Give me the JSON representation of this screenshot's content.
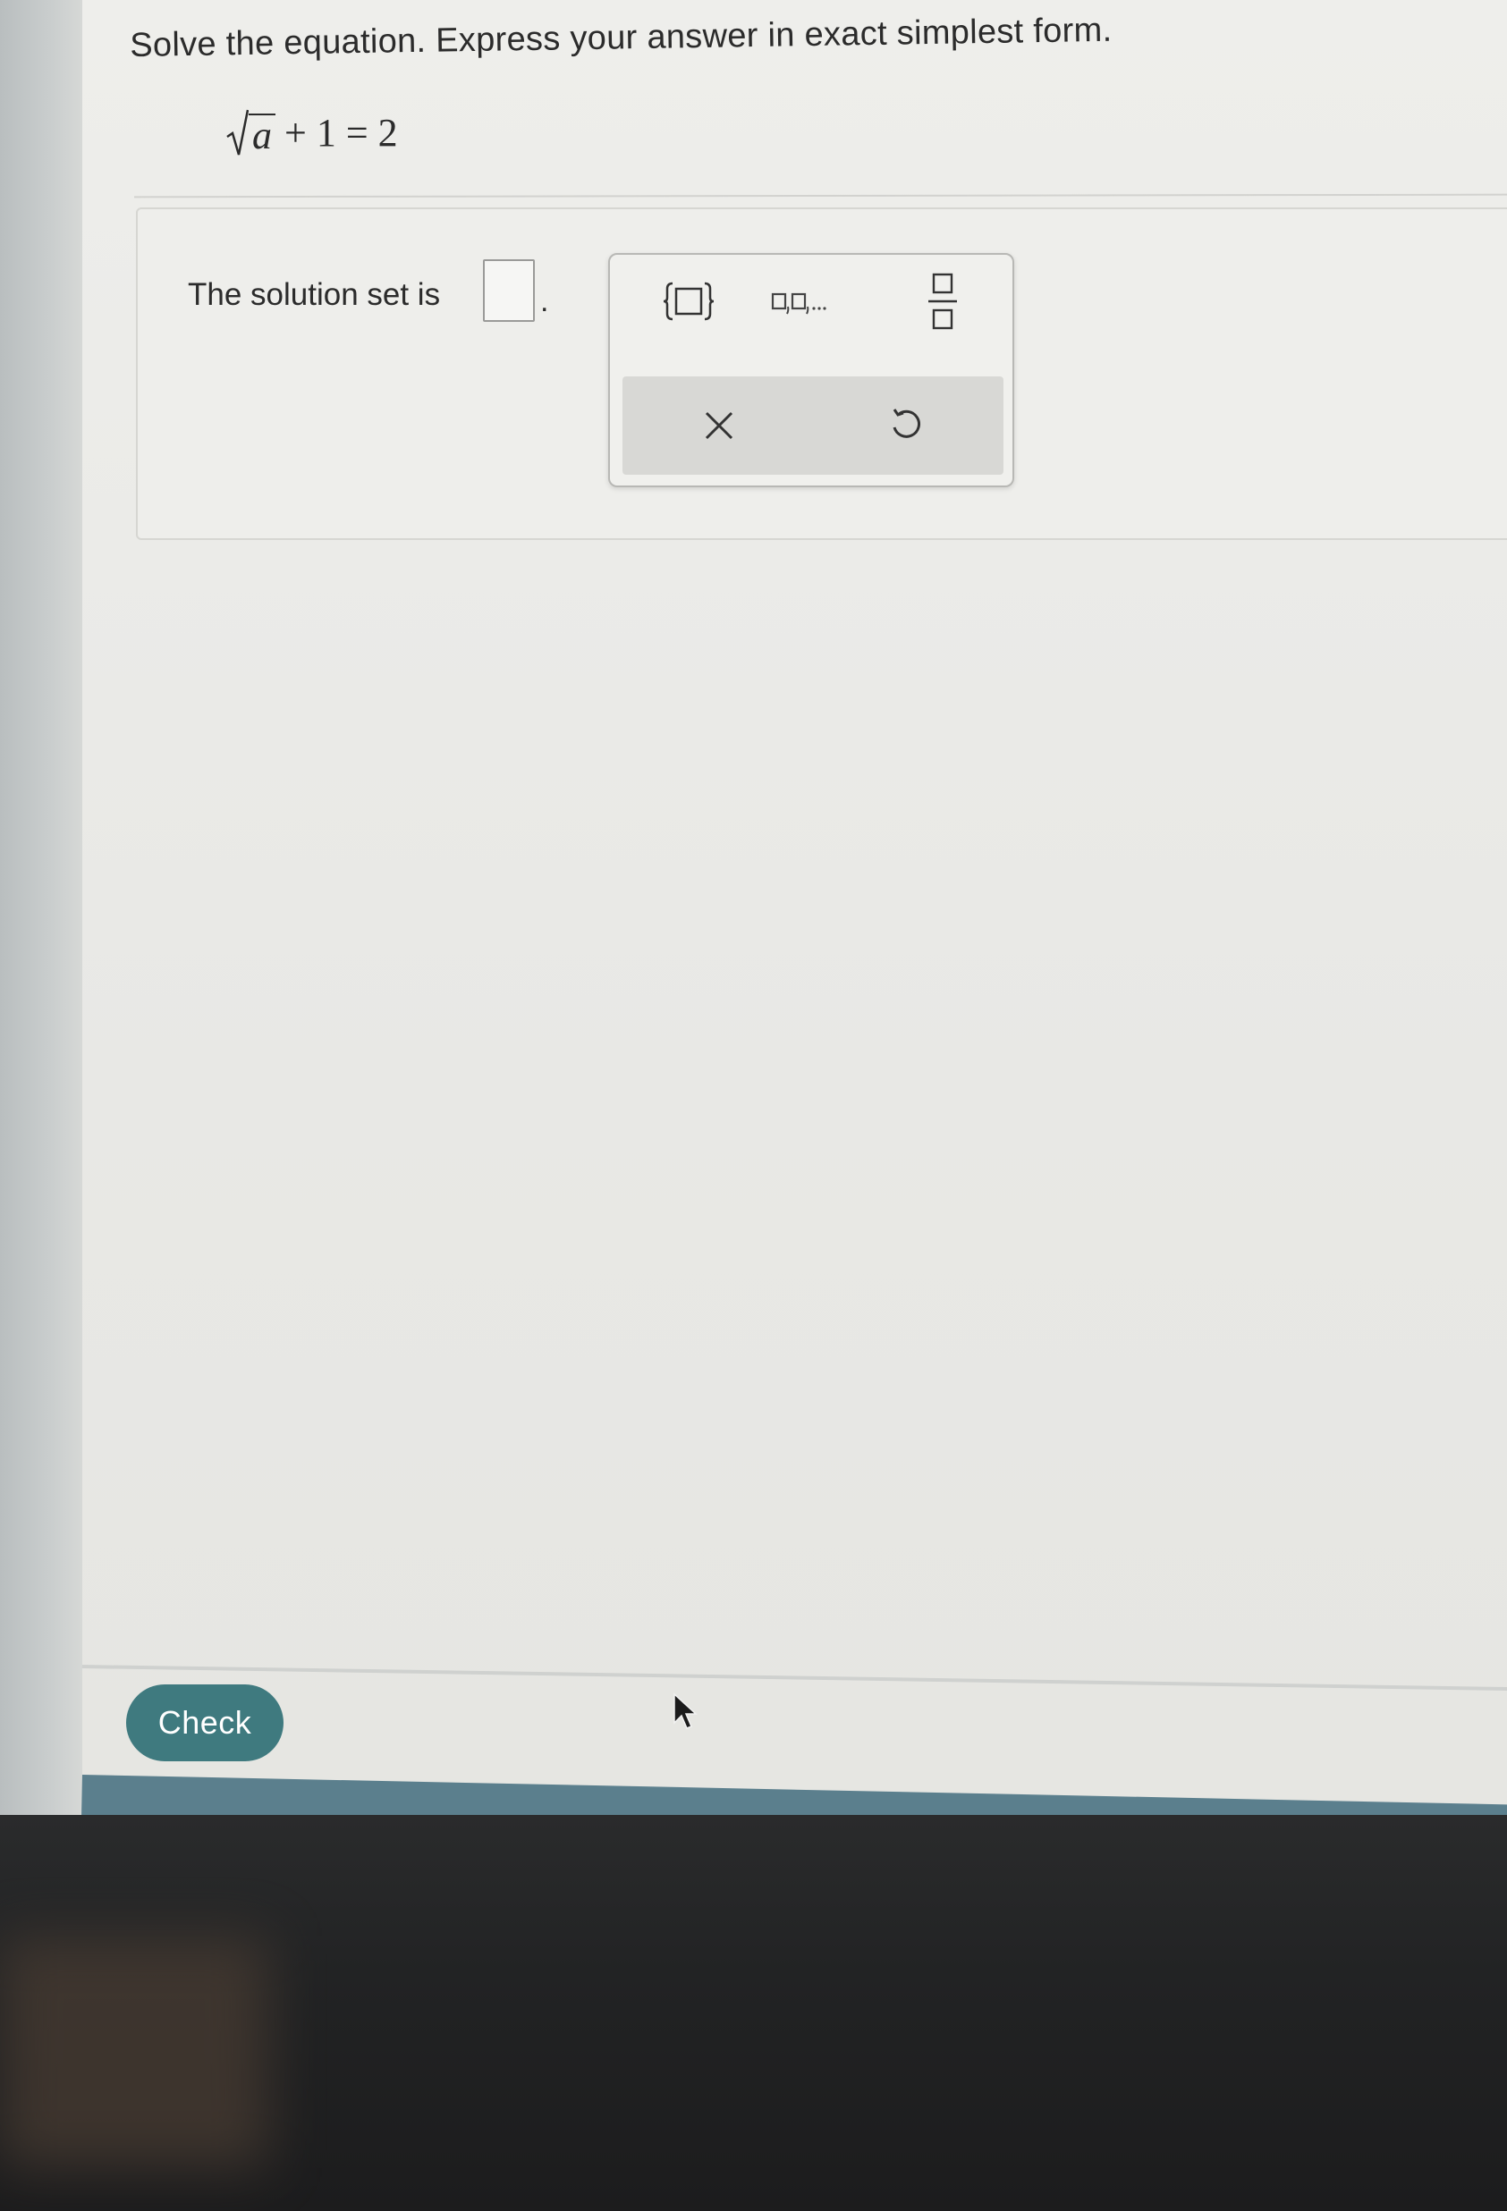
{
  "question": {
    "prompt": "Solve the equation. Express your answer in exact simplest form.",
    "equation": {
      "radicand": "a",
      "rest": "+ 1 = 2"
    }
  },
  "answer": {
    "label": "The solution set is",
    "value": "",
    "period": "."
  },
  "toolbox": {
    "buttons": [
      {
        "name": "set-braces",
        "icon": "set-braces-icon"
      },
      {
        "name": "list",
        "icon": "list-icon"
      },
      {
        "name": "fraction",
        "icon": "fraction-icon"
      },
      {
        "name": "clear",
        "icon": "clear-x-icon",
        "symbol": "×"
      },
      {
        "name": "undo",
        "icon": "undo-icon"
      }
    ]
  },
  "footer": {
    "check_label": "Check"
  },
  "colors": {
    "check_button": "#3f7a7f",
    "footer_bar": "#5b7f8d",
    "text": "#2b2b2b"
  }
}
